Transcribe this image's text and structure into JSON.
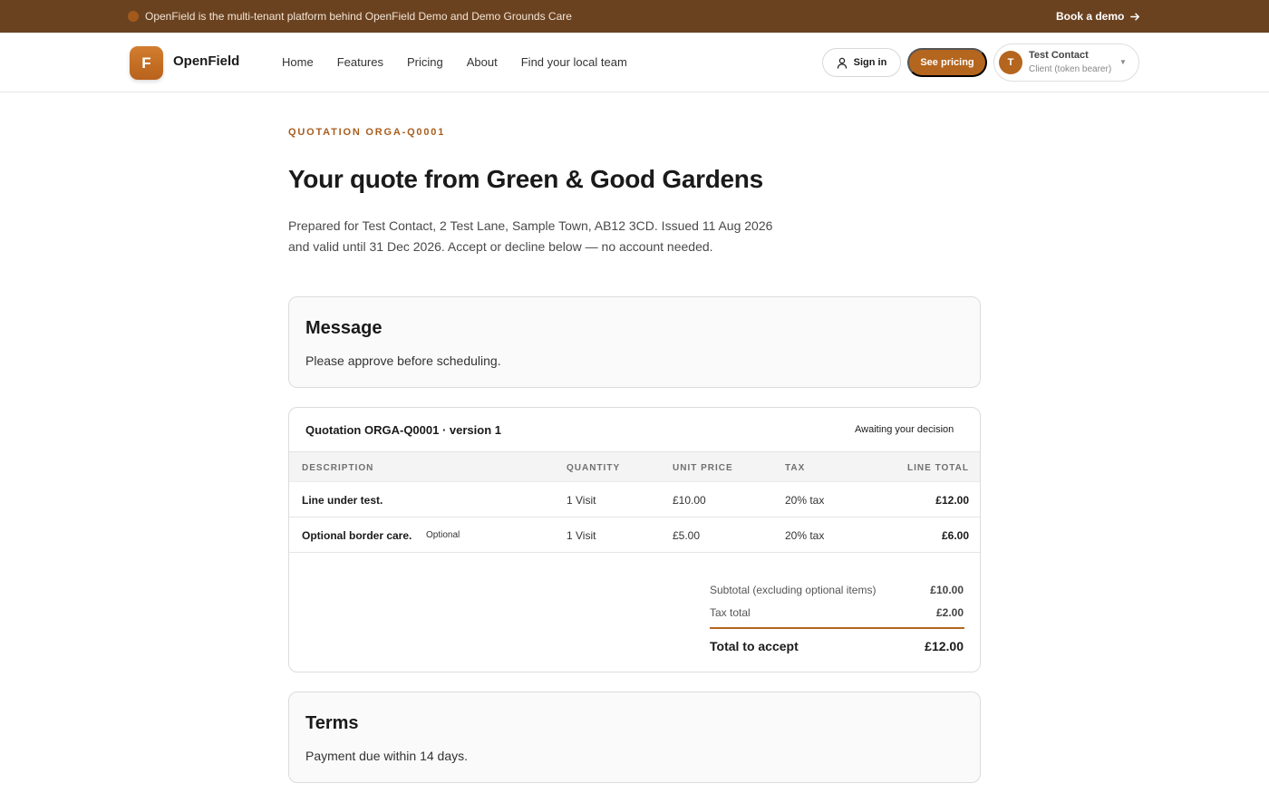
{
  "announcement": {
    "text": "OpenField is the multi-tenant platform behind OpenField Demo and Demo Grounds Care",
    "cta": "Book a demo"
  },
  "header": {
    "logo_letter": "F",
    "brand": "OpenField",
    "nav": [
      "Home",
      "Features",
      "Pricing",
      "About",
      "Find your local team"
    ],
    "sign_in": "Sign in",
    "see_pricing": "See pricing",
    "account": {
      "initial": "T",
      "name": "Test Contact",
      "role": "Client (token bearer)"
    }
  },
  "main": {
    "eyebrow": "QUOTATION ORGA-Q0001",
    "title": "Your quote from Green & Good Gardens",
    "intro": "Prepared for Test Contact, 2 Test Lane, Sample Town, AB12 3CD. Issued 11 Aug 2026 and valid until 31 Dec 2026. Accept or decline below — no account needed.",
    "message": {
      "heading": "Message",
      "body": "Please approve before scheduling."
    },
    "quotation": {
      "title": "Quotation ORGA-Q0001 · version 1",
      "status": "Awaiting your decision",
      "columns": [
        "DESCRIPTION",
        "QUANTITY",
        "UNIT PRICE",
        "TAX",
        "LINE TOTAL"
      ],
      "rows": [
        {
          "description": "Line under test.",
          "optional_tag": "",
          "quantity": "1 Visit",
          "unit_price": "£10.00",
          "tax": "20% tax",
          "line_total": "£12.00"
        },
        {
          "description": "Optional border care.",
          "optional_tag": "Optional",
          "quantity": "1 Visit",
          "unit_price": "£5.00",
          "tax": "20% tax",
          "line_total": "£6.00"
        }
      ],
      "summary": {
        "subtotal_label": "Subtotal (excluding optional items)",
        "subtotal_value": "£10.00",
        "tax_label": "Tax total",
        "tax_value": "£2.00",
        "total_label": "Total to accept",
        "total_value": "£12.00"
      }
    },
    "terms": {
      "heading": "Terms",
      "body": "Payment due within 14 days."
    }
  },
  "colors": {
    "announcement_bg": "#6b4220",
    "accent": "#b4661f",
    "eyebrow": "#a85e1f"
  }
}
